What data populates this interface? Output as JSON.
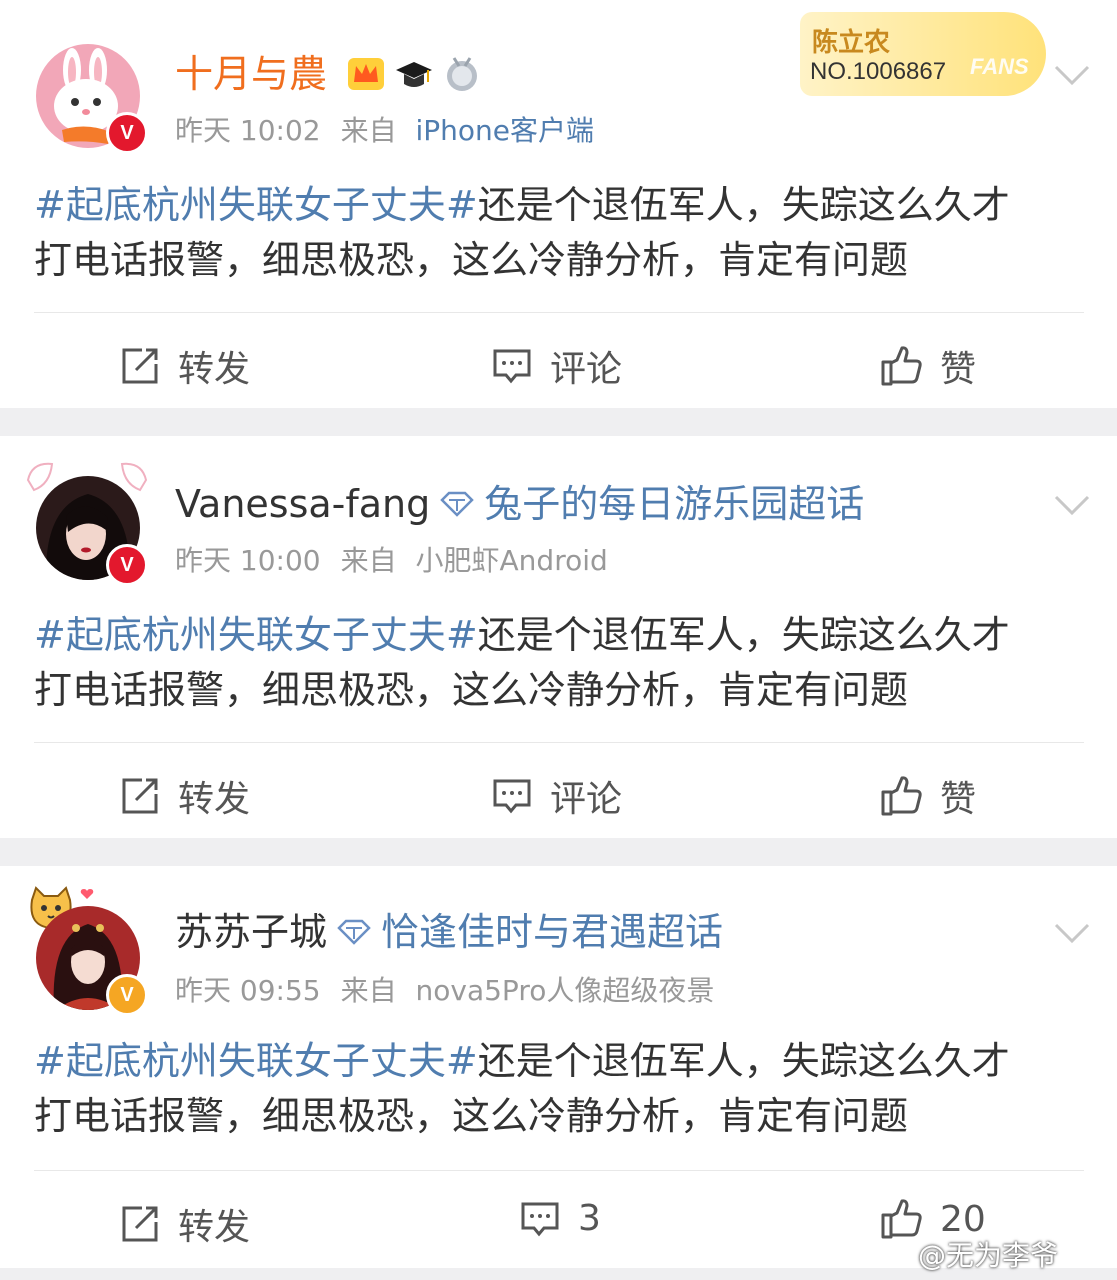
{
  "colors": {
    "link_blue": "#507daf",
    "username_orange": "#f06e1e",
    "text_main": "#333333",
    "text_meta": "#999999",
    "verified_red": "#e3182d",
    "verified_gold": "#f5a623"
  },
  "fans_card": {
    "name": "陈立农",
    "number": "NO.1006867",
    "tag": "FANS"
  },
  "posts": [
    {
      "username": "十月与農",
      "badges": [
        "crown-badge-icon",
        "graduation-cap-icon",
        "medal-icon"
      ],
      "time": "昨天 10:02",
      "source_prefix": "来自",
      "source": "iPhone客户端",
      "topic": "#起底杭州失联女子丈夫#",
      "text_line1": "还是个退伍军人，失踪这么久才",
      "text_line2": "打电话报警，细思极恐，这么冷静分析，肯定有问题",
      "repost_label": "转发",
      "comment_label": "评论",
      "like_label": "赞"
    },
    {
      "username": "Vanessa-fang",
      "super_topic": "兔子的每日游乐园超话",
      "time": "昨天 10:00",
      "source_prefix": "来自",
      "source": "小肥虾Android",
      "topic": "#起底杭州失联女子丈夫#",
      "text_line1": "还是个退伍军人，失踪这么久才",
      "text_line2": "打电话报警，细思极恐，这么冷静分析，肯定有问题",
      "repost_label": "转发",
      "comment_label": "评论",
      "like_label": "赞"
    },
    {
      "username": "苏苏子城",
      "super_topic": "恰逢佳时与君遇超话",
      "time": "昨天 09:55",
      "source_prefix": "来自",
      "source": "nova5Pro人像超级夜景",
      "topic": "#起底杭州失联女子丈夫#",
      "text_line1": "还是个退伍军人，失踪这么久才",
      "text_line2": "打电话报警，细思极恐，这么冷静分析，肯定有问题",
      "repost_label": "转发",
      "comment_label": "3",
      "like_label": "20"
    }
  ],
  "watermark": "@无为李爷"
}
